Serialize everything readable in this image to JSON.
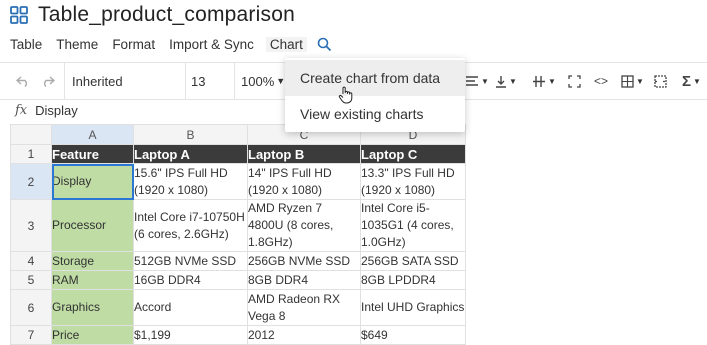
{
  "title": "Table_product_comparison",
  "menu": [
    "Table",
    "Theme",
    "Format",
    "Import & Sync",
    "Chart"
  ],
  "toolbar": {
    "font": "Inherited",
    "font_size": "13",
    "zoom": "100%"
  },
  "formula_bar": {
    "value": "Display"
  },
  "chart_dropdown": [
    "Create chart from data",
    "View existing charts"
  ],
  "grid": {
    "columns": [
      "A",
      "B",
      "C",
      "D"
    ],
    "rows": [
      {
        "num": "1",
        "cells": [
          "Feature",
          "Laptop A",
          "Laptop B",
          "Laptop C"
        ]
      },
      {
        "num": "2",
        "cells": [
          "Display",
          "15.6\" IPS Full HD (1920 x 1080)",
          "14\" IPS Full HD (1920 x 1080)",
          "13.3\" IPS Full HD (1920 x 1080)"
        ]
      },
      {
        "num": "3",
        "cells": [
          "Processor",
          "Intel Core i7-10750H (6 cores, 2.6GHz)",
          "AMD Ryzen 7 4800U (8 cores, 1.8GHz)",
          "Intel Core i5-1035G1 (4 cores, 1.0GHz)"
        ]
      },
      {
        "num": "4",
        "cells": [
          "Storage",
          "512GB NVMe SSD",
          "256GB NVMe SSD",
          "256GB SATA SSD"
        ]
      },
      {
        "num": "5",
        "cells": [
          "RAM",
          "16GB DDR4",
          "8GB DDR4",
          "8GB LPDDR4"
        ]
      },
      {
        "num": "6",
        "cells": [
          "Graphics",
          "Accord",
          "AMD Radeon RX Vega 8",
          "Intel UHD Graphics"
        ]
      },
      {
        "num": "7",
        "cells": [
          "Price",
          "$1,199",
          "2012",
          "$649"
        ]
      }
    ]
  },
  "colors": {
    "header_row_bg": "#3b3b3b",
    "feature_col_bg": "#bfdca5",
    "selection": "#2a78d4",
    "title_icon": "#2a6fb5"
  }
}
